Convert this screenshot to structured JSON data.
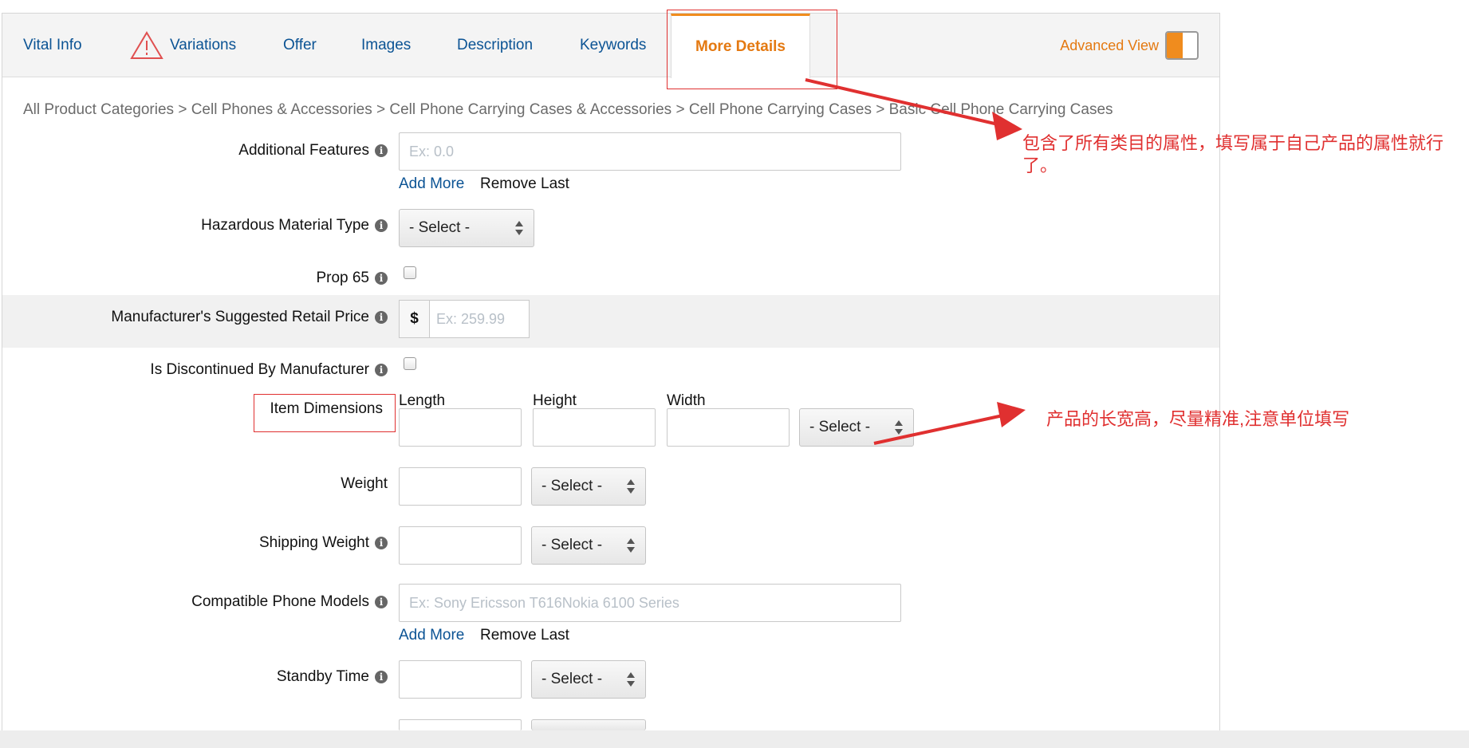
{
  "tabs": [
    {
      "label": "Vital Info",
      "active": false
    },
    {
      "label": "Variations",
      "active": false,
      "icon": "warning-icon"
    },
    {
      "label": "Offer",
      "active": false
    },
    {
      "label": "Images",
      "active": false
    },
    {
      "label": "Description",
      "active": false
    },
    {
      "label": "Keywords",
      "active": false
    },
    {
      "label": "More Details",
      "active": true
    }
  ],
  "advanced_view": {
    "label": "Advanced View",
    "state": "on"
  },
  "breadcrumb": "All Product Categories > Cell Phones & Accessories > Cell Phone Carrying Cases & Accessories > Cell Phone Carrying Cases > Basic Cell Phone Carrying Cases",
  "fields": {
    "additional_features": {
      "label": "Additional Features",
      "placeholder": "Ex: 0.0",
      "add_more": "Add More",
      "remove_last": "Remove Last"
    },
    "hazardous_material": {
      "label": "Hazardous Material Type",
      "select": "- Select -"
    },
    "prop65": {
      "label": "Prop 65",
      "checked": false
    },
    "msrp": {
      "label": "Manufacturer's Suggested Retail Price",
      "currency": "$",
      "placeholder": "Ex: 259.99"
    },
    "discontinued": {
      "label": "Is Discontinued By Manufacturer",
      "checked": false
    },
    "item_dimensions": {
      "label": "Item Dimensions",
      "length": "Length",
      "height": "Height",
      "width": "Width",
      "unit_select": "- Select -"
    },
    "weight": {
      "label": "Weight",
      "select": "- Select -"
    },
    "shipping_weight": {
      "label": "Shipping Weight",
      "select": "- Select -"
    },
    "compatible_models": {
      "label": "Compatible Phone Models",
      "placeholder": "Ex: Sony Ericsson T616Nokia 6100 Series",
      "add_more": "Add More",
      "remove_last": "Remove Last"
    },
    "standby_time": {
      "label": "Standby Time",
      "select": "- Select -"
    }
  },
  "annotations": {
    "note1": "包含了所有类目的属性，填写属于自己产品的属性就行了。",
    "note2": "产品的长宽高，尽量精准,注意单位填写",
    "color": "#e03030"
  },
  "colors": {
    "accent": "#e47911",
    "link": "#0b5394"
  }
}
